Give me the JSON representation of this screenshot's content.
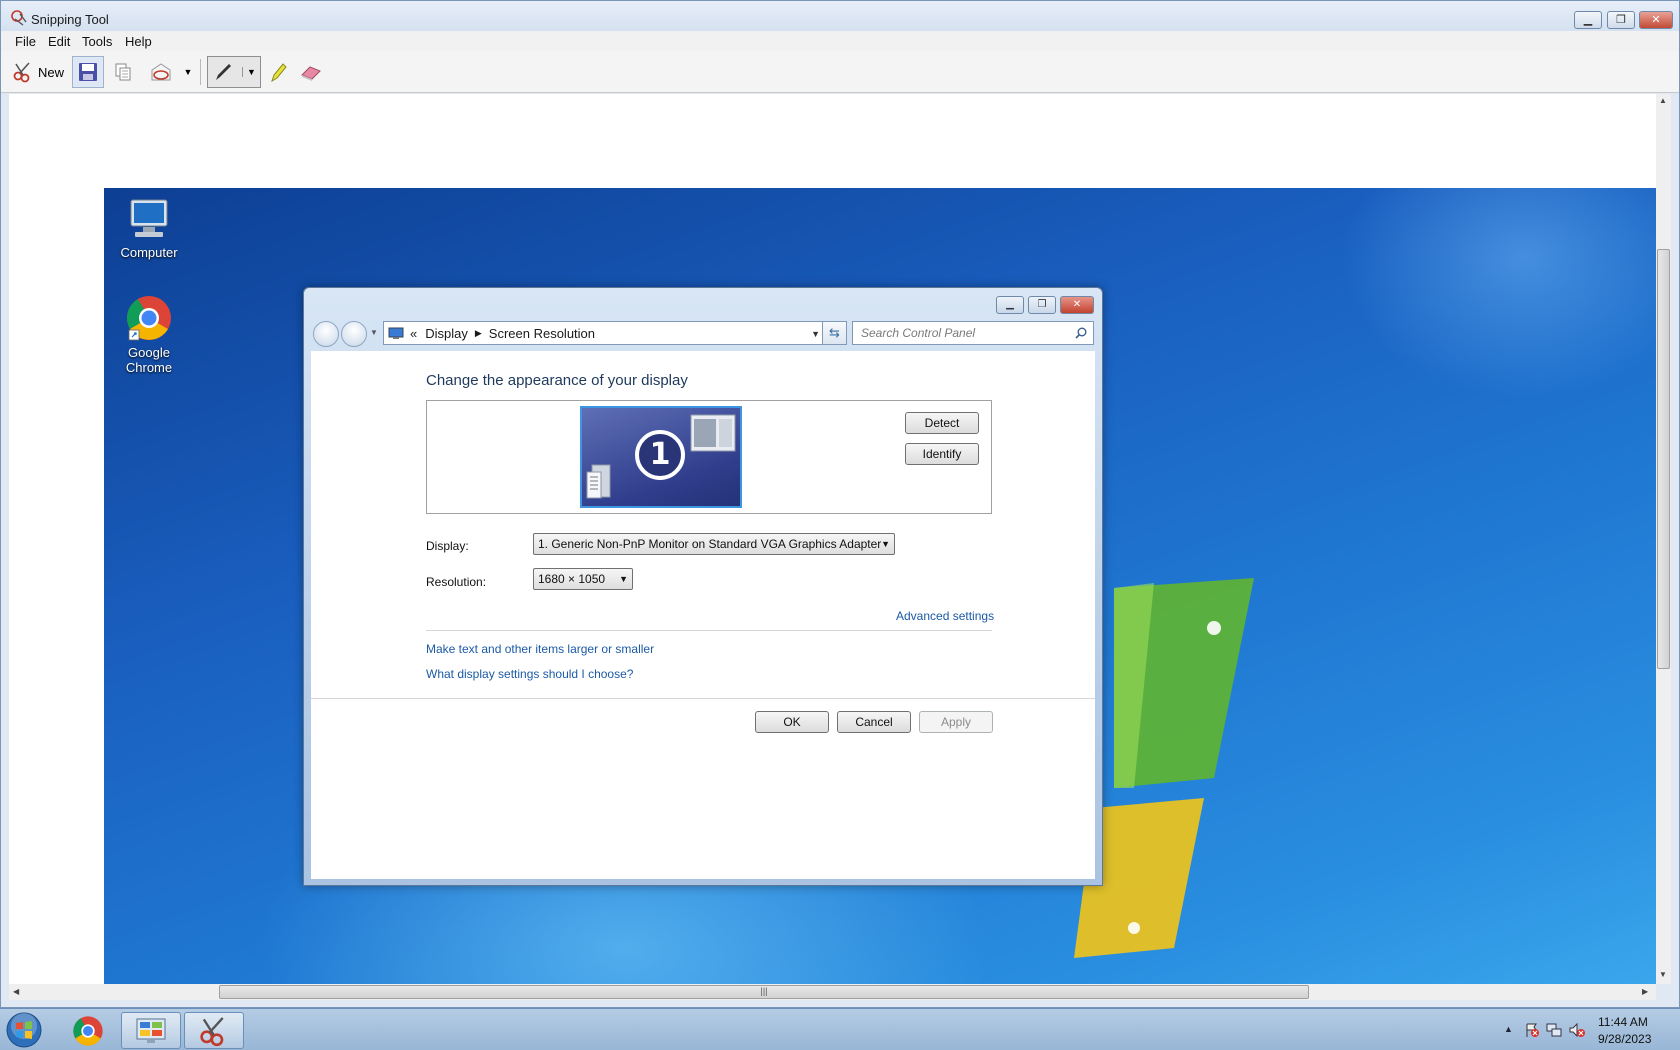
{
  "snipping_tool": {
    "title": "Snipping Tool",
    "menu": [
      "File",
      "Edit",
      "Tools",
      "Help"
    ],
    "toolbar": {
      "new_label": "New"
    }
  },
  "desktop": {
    "icons": [
      {
        "label": "Computer"
      },
      {
        "label": "Google Chrome"
      }
    ]
  },
  "dialog": {
    "breadcrumb_prefix": "«",
    "breadcrumb": [
      "Display",
      "Screen Resolution"
    ],
    "search_placeholder": "Search Control Panel",
    "heading": "Change the appearance of your display",
    "monitor_number": "1",
    "detect_label": "Detect",
    "identify_label": "Identify",
    "display_label": "Display:",
    "display_value": "1. Generic Non-PnP Monitor on Standard VGA Graphics Adapter",
    "resolution_label": "Resolution:",
    "resolution_value": "1680 × 1050",
    "advanced_link": "Advanced settings",
    "link_text_size": "Make text and other items larger or smaller",
    "link_help": "What display settings should I choose?",
    "ok_label": "OK",
    "cancel_label": "Cancel",
    "apply_label": "Apply"
  },
  "taskbar": {
    "time": "11:44 AM",
    "date": "9/28/2023"
  },
  "colors": {
    "link": "#1c5aa6",
    "heading": "#1e395b",
    "desktop_blue": "#1a5fbf",
    "taskbar": "#a9c3df"
  }
}
